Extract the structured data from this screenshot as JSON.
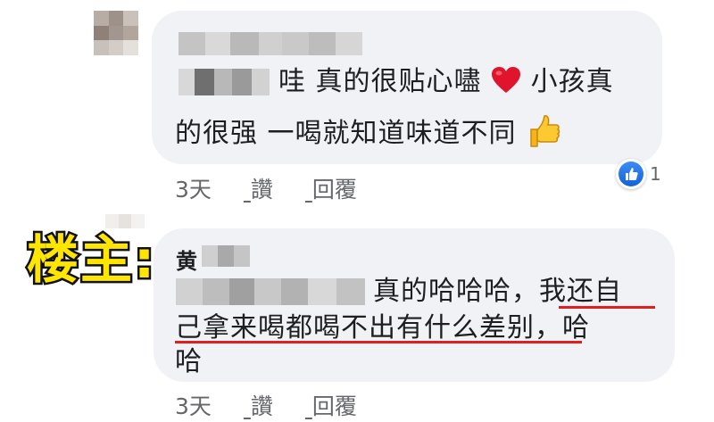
{
  "comment1": {
    "line1": "哇 真的很贴心嚍",
    "heart_icon": "red-heart",
    "line1_tail": "小孩真",
    "line2": "的很强 一喝就知道味道不同",
    "thumbs_icon": "thumbs-up",
    "actions": {
      "time": "3天",
      "like": "讚",
      "reply": "回覆"
    },
    "reaction_count": "1"
  },
  "comment2": {
    "owner_label": "楼主:",
    "author_name": "黄",
    "line1_plain": "真的哈哈哈，",
    "line1_underlined": "我还自",
    "line2_underlined": "己拿来喝都喝不出有什么差别",
    "line2_tail": "，哈",
    "line3": "哈",
    "actions": {
      "time": "3天",
      "like": "讚",
      "reply": "回覆"
    }
  },
  "colors": {
    "bubble": "#f0f2f5",
    "meta_text": "#65676b",
    "underline": "#e02020",
    "label_fill": "#ffe600",
    "like_blue": "#1877f2"
  }
}
